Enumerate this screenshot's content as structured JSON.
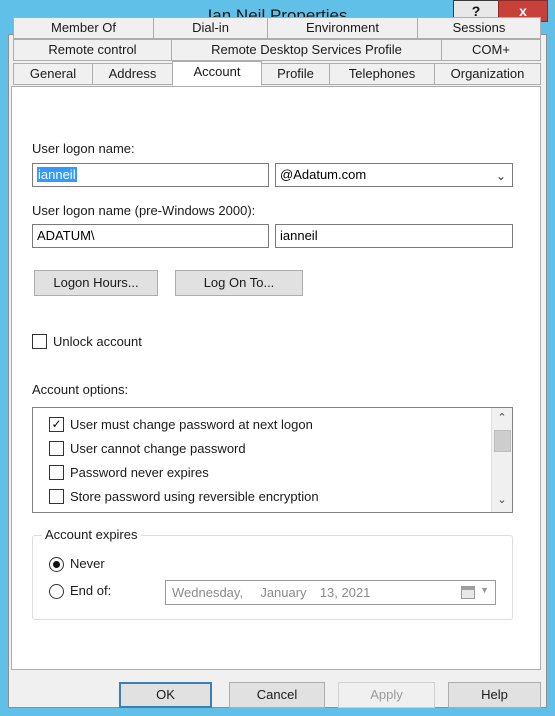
{
  "window": {
    "title": "Ian Neil Properties",
    "help_label": "?",
    "close_label": "x"
  },
  "tabs": {
    "row1": [
      "Member Of",
      "Dial-in",
      "Environment",
      "Sessions"
    ],
    "row2": [
      "Remote control",
      "Remote Desktop Services Profile",
      "COM+"
    ],
    "row3": [
      "General",
      "Address",
      "Account",
      "Profile",
      "Telephones",
      "Organization"
    ],
    "active": "Account"
  },
  "account": {
    "logon_name_label": "User logon name:",
    "logon_name_value": "ianneil",
    "domain_value": "@Adatum.com",
    "pre2000_label": "User logon name (pre-Windows 2000):",
    "pre2000_domain": "ADATUM\\",
    "pre2000_name": "ianneil",
    "logon_hours_label": "Logon Hours...",
    "log_on_to_label": "Log On To...",
    "unlock_label": "Unlock account",
    "options_label": "Account options:",
    "options": [
      {
        "label": "User must change password at next logon",
        "checked": true
      },
      {
        "label": "User cannot change password",
        "checked": false
      },
      {
        "label": "Password never expires",
        "checked": false
      },
      {
        "label": "Store password using reversible encryption",
        "checked": false
      }
    ],
    "expires": {
      "title": "Account expires",
      "never_label": "Never",
      "end_of_label": "End of:",
      "date_weekday": "Wednesday,",
      "date_month": "January",
      "date_rest": "13, 2021"
    }
  },
  "buttons": {
    "ok": "OK",
    "cancel": "Cancel",
    "apply": "Apply",
    "help": "Help"
  }
}
